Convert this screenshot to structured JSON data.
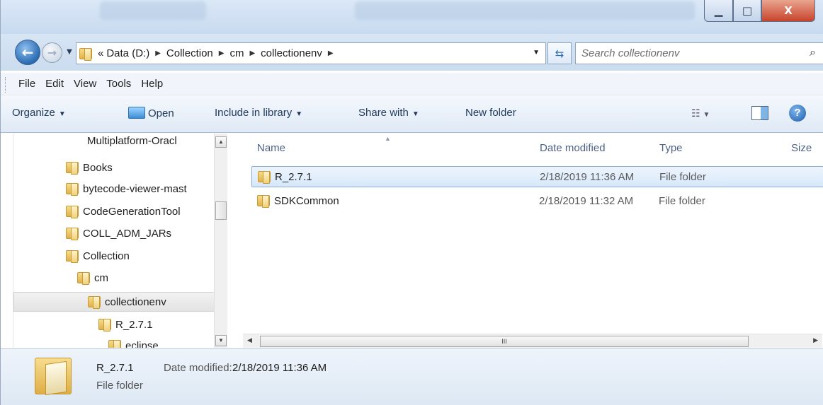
{
  "window": {
    "min_glyph": "▁",
    "max_glyph": "□",
    "close_glyph": "X"
  },
  "address": {
    "overflow": "«",
    "crumbs": [
      "Data (D:)",
      "Collection",
      "cm",
      "collectionenv"
    ],
    "search_placeholder": "Search collectionenv"
  },
  "menu": [
    "File",
    "Edit",
    "View",
    "Tools",
    "Help"
  ],
  "commands": {
    "organize": "Organize",
    "open": "Open",
    "include": "Include in library",
    "share": "Share with",
    "new_folder": "New folder"
  },
  "tree": {
    "items": [
      {
        "label": "Multiplatform-Oracl",
        "indent": 1
      },
      {
        "label": "Books",
        "indent": 0
      },
      {
        "label": "bytecode-viewer-mast",
        "indent": 0
      },
      {
        "label": "CodeGenerationTool",
        "indent": 0
      },
      {
        "label": "COLL_ADM_JARs",
        "indent": 0
      },
      {
        "label": "Collection",
        "indent": 0
      },
      {
        "label": "cm",
        "indent": 1
      },
      {
        "label": "collectionenv",
        "indent": 2,
        "selected": true
      },
      {
        "label": "R_2.7.1",
        "indent": 3
      },
      {
        "label": "eclipse",
        "indent": 4
      }
    ]
  },
  "columns": {
    "name": "Name",
    "date": "Date modified",
    "type": "Type",
    "size": "Size"
  },
  "files": [
    {
      "name": "R_2.7.1",
      "date": "2/18/2019 11:36 AM",
      "type": "File folder",
      "selected": true
    },
    {
      "name": "SDKCommon",
      "date": "2/18/2019 11:32 AM",
      "type": "File folder"
    }
  ],
  "hscroll_grip": "III",
  "details": {
    "name": "R_2.7.1",
    "date_label": "Date modified:",
    "date_value": "2/18/2019 11:36 AM",
    "type": "File folder"
  }
}
